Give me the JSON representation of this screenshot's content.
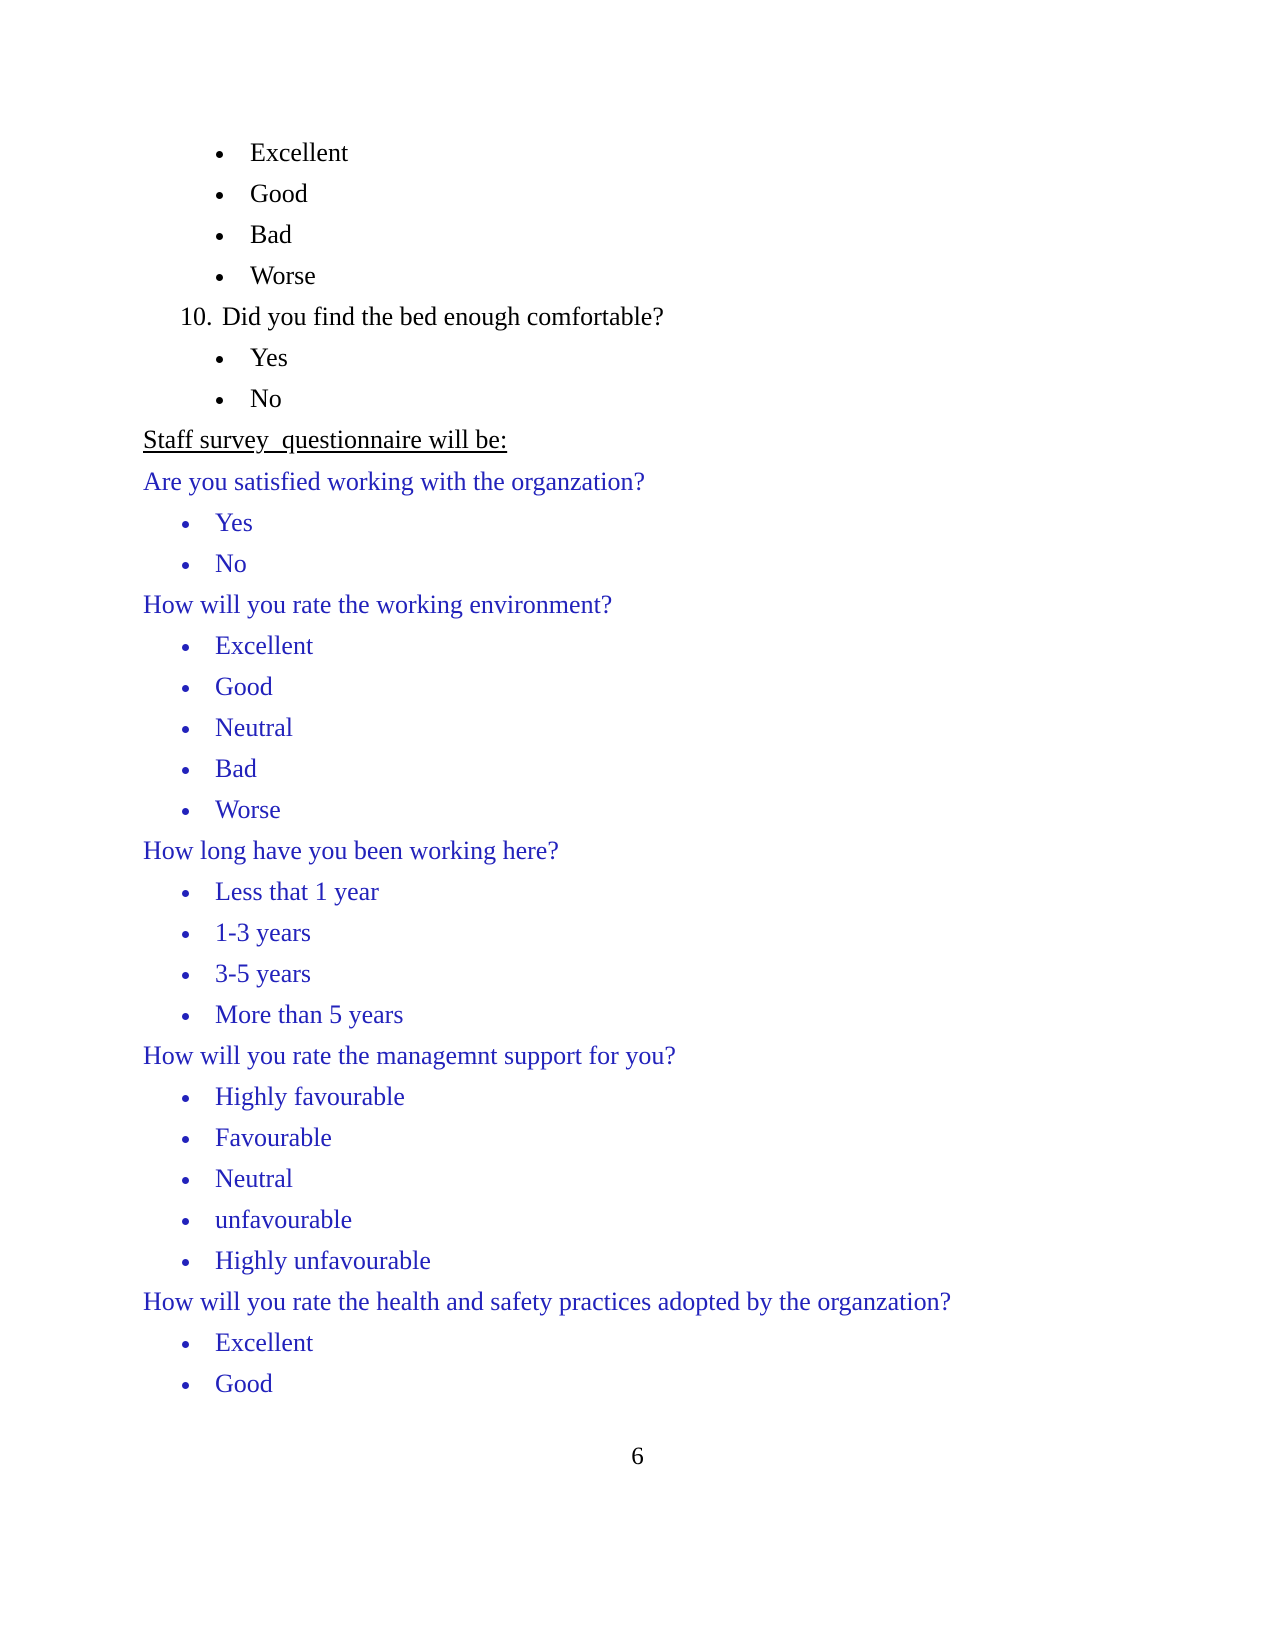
{
  "document": {
    "page_number": "6",
    "colors": {
      "black_text": "#000000",
      "blue_text": "#2222bb",
      "background": "#ffffff"
    }
  },
  "patient_section": {
    "rating_options": [
      {
        "label": "Excellent"
      },
      {
        "label": "Good"
      },
      {
        "label": "Bad"
      },
      {
        "label": "Worse"
      }
    ],
    "question_10": {
      "number": "10.",
      "text": "Did you find the bed enough comfortable?",
      "options": [
        {
          "label": "Yes"
        },
        {
          "label": "No"
        }
      ]
    }
  },
  "staff_section": {
    "heading": "Staff survey  questionnaire will be:",
    "questions": [
      {
        "text": "Are you satisfied working with the organzation?",
        "options": [
          {
            "label": "Yes"
          },
          {
            "label": "No"
          }
        ]
      },
      {
        "text": "How will you rate the working environment?",
        "options": [
          {
            "label": "Excellent"
          },
          {
            "label": "Good"
          },
          {
            "label": "Neutral"
          },
          {
            "label": "Bad"
          },
          {
            "label": "Worse"
          }
        ]
      },
      {
        "text": "How long have you been working here?",
        "options": [
          {
            "label": "Less that 1 year"
          },
          {
            "label": "1-3 years"
          },
          {
            "label": "3-5 years"
          },
          {
            "label": "More than 5 years"
          }
        ]
      },
      {
        "text": "How will you rate the managemnt support for you?",
        "options": [
          {
            "label": "Highly favourable"
          },
          {
            "label": "Favourable"
          },
          {
            "label": "Neutral"
          },
          {
            "label": "unfavourable"
          },
          {
            "label": "Highly unfavourable"
          }
        ]
      },
      {
        "text": "How will you rate the health and safety practices adopted by the organzation?",
        "options": [
          {
            "label": "Excellent"
          },
          {
            "label": "Good"
          }
        ]
      }
    ]
  }
}
